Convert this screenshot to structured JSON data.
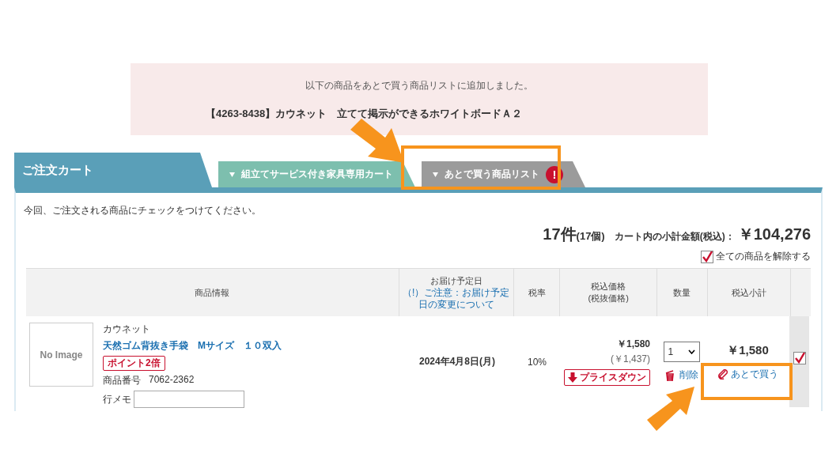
{
  "notice": {
    "message": "以下の商品をあとで買う商品リストに追加しました。",
    "item": "【4263-8438】カウネット　立てて掲示ができるホワイトボードＡ２"
  },
  "cart_title": "ご注文カート",
  "tabs": [
    {
      "label": "組立てサービス付き家具専用カート",
      "color": "#7dbfae"
    },
    {
      "label": "あとで買う商品リスト",
      "color": "#9b9b9b",
      "badge": "!"
    }
  ],
  "instruction": "今回、ご注文される商品にチェックをつけてください。",
  "summary": {
    "count": "17件",
    "pieces": "(17個)",
    "label": "カート内の小計金額(税込)：",
    "total": "￥104,276"
  },
  "uncheck_all": {
    "label": "全ての商品を解除する",
    "checked": true
  },
  "table": {
    "columns": [
      {
        "label": "商品情報"
      },
      {
        "label": "お届け予定日",
        "note": "（!）ご注意：お届け予定日の変更について"
      },
      {
        "label": "税率"
      },
      {
        "label": "税込価格\n(税抜価格)"
      },
      {
        "label": "数量"
      },
      {
        "label": "税込小計"
      }
    ],
    "rows": [
      {
        "maker": "カウネット",
        "name": "天然ゴム背抜き手袋　Mサイズ　１０双入",
        "tag": "ポイント2倍",
        "item_no_label": "商品番号",
        "item_no": "7062-2362",
        "memo_label": "行メモ",
        "image_text": "No Image",
        "delivery": "2024年4月8日(月)",
        "tax": "10%",
        "price": "￥1,580",
        "price_ex": "(￥1,437)",
        "price_down": "プライスダウン",
        "qty": "1",
        "delete": "削除",
        "later": "あとで買う",
        "subtotal": "￥1,580",
        "checked": true
      }
    ]
  }
}
